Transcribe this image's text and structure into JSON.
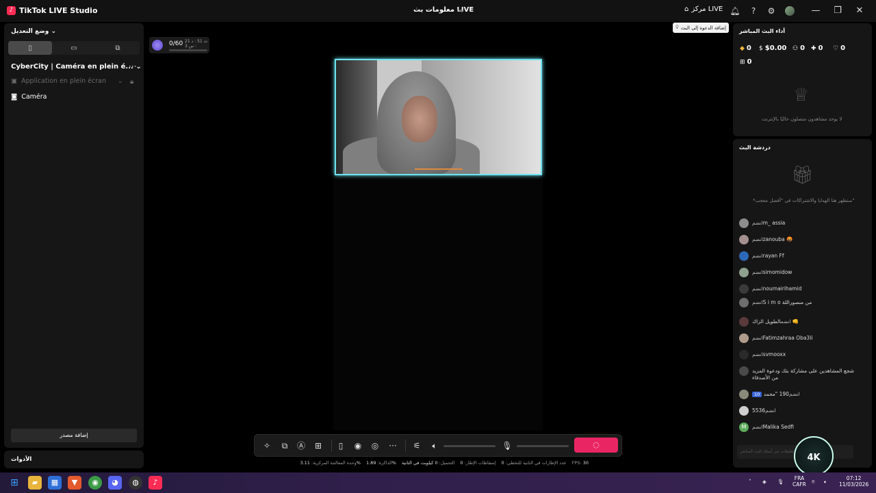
{
  "titlebar": {
    "app_title": "TikTok LIVE Studio",
    "center_title": "معلومات بث LIVE",
    "live_center_label": "مركز LIVE"
  },
  "left_panel": {
    "mode_title": "وضع التعديل",
    "scene_name": "CyberCity | Caméra en plein é...",
    "sources": [
      "Application en plein écran",
      "Caméra"
    ],
    "add_source_label": "إضافة مصدر",
    "tools_label": "الأدوات"
  },
  "preview": {
    "goal_count": "0/60",
    "goal_time": "ث 51 : د 21 : س 3",
    "tip_text": "إضافة الدعوة إلى البث"
  },
  "stats": {
    "cpu_label": "وحدة المعالجة المركزية:",
    "cpu_value": "3.11%",
    "memory_label": "الذاكرة:",
    "memory_value": "1.89%",
    "upload_label": "التحميل:",
    "upload_value": "0 كيلوبت في الثانية",
    "drops_label": "إسقاطات الإطار:",
    "drops_value": "0",
    "frames_label": "عدد الإطارات في الثانية للتخطي:",
    "frames_value": "0",
    "fps_label": "FPS:",
    "fps_value": "30"
  },
  "performance": {
    "title": "أداء البث المباشر",
    "diamonds": "0",
    "earnings": "$0.00",
    "viewers": "0",
    "new_followers": "0",
    "likes": "0",
    "gifts": "0",
    "empty_text": "لا يوجد مشاهدون متصلون حاليًا بالإنترنت"
  },
  "chat": {
    "title": "دردشة البث",
    "empty_text": "*ستظهر هنا الهدايا والاشتراكات في \"أفضل معجب\"",
    "joined": "انضم",
    "messages": [
      {
        "user": "m_ assia",
        "avatar_color": "#8c8c8c"
      },
      {
        "user": "zanouba 🤬",
        "avatar_color": "#a58f8f"
      },
      {
        "user": "rayan Ff",
        "avatar_color": "#2e67b8"
      },
      {
        "user": "simomidow",
        "avatar_color": "#8fa18f"
      },
      {
        "user": "noumairihamid",
        "avatar_color": "#3a3a3a"
      },
      {
        "user": "S i m o من منصوراللة",
        "avatar_color": "#6e6e6e"
      },
      {
        "user": "الطويل الزاك 👊",
        "avatar_color": "#5a3a3a"
      },
      {
        "user": "Fatimzahraa Oba3li",
        "avatar_color": "#b09a8a"
      },
      {
        "user": "svmooxx",
        "avatar_color": "#2a2a2a"
      },
      {
        "user": "شجع المشاهدين على مشاركة بثك ودعوة المزيد من الأصدقاء",
        "avatar_color": "#4a4a4a",
        "system": true
      },
      {
        "user": "190 \"محمد",
        "badge": "10",
        "avatar_color": "#8a8a7a"
      },
      {
        "user": "5536",
        "avatar_color": "#cfcfcf"
      },
      {
        "user": "Malika Sedfi",
        "avatar_color": "#5aaa5a",
        "initial": "M"
      }
    ],
    "input_placeholder": "أرسل تعليقات عبر أسئلة البث المباشر"
  },
  "watermark_text": "4K",
  "taskbar": {
    "lang_top": "FRA",
    "lang_bottom": "CAFR",
    "time": "07:12",
    "date": "11/03/2026"
  },
  "colors": {
    "accent": "#ea2563",
    "frame": "#6ee3ef",
    "panel": "#161616"
  }
}
